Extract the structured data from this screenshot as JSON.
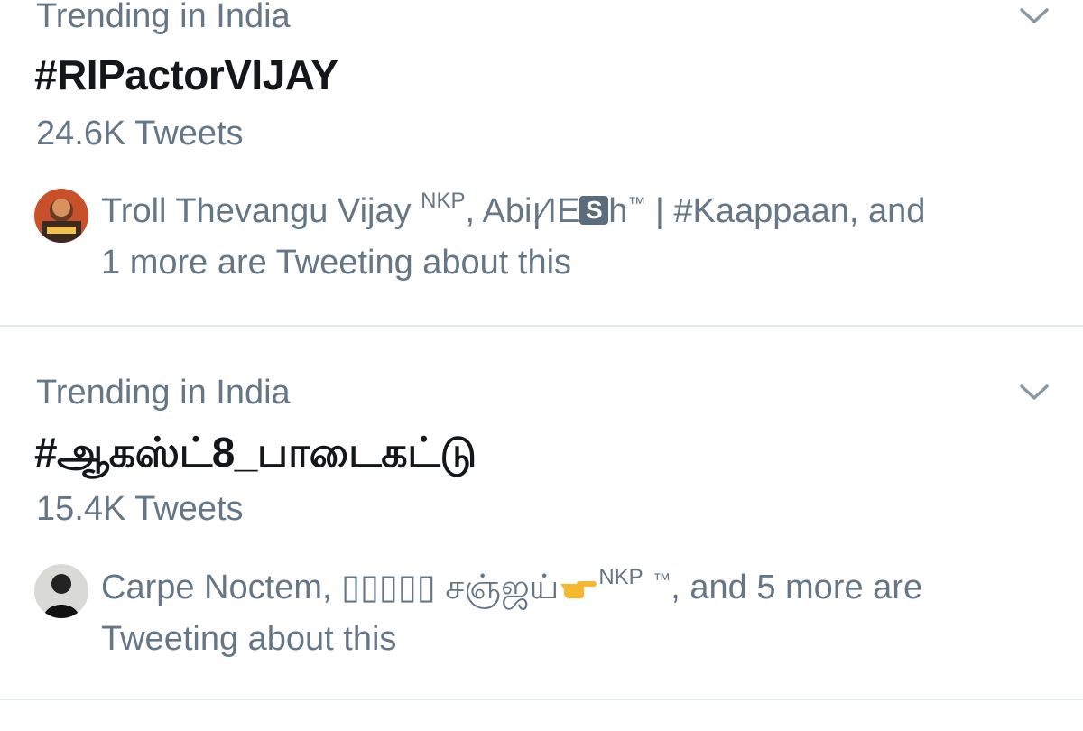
{
  "trends": [
    {
      "context": "Trending in India",
      "hashtag": "#RIPactorVIJAY",
      "tweet_count": "24.6K Tweets",
      "avatar_icon": "user-avatar",
      "activity": {
        "name_1": "Troll Thevangu Vijay",
        "name_1_sup": "NKP",
        "sep_1": ", ",
        "name_2_a": "Abiꞁ⁄ΙΕ",
        "name_2_box": "S",
        "name_2_b": "h",
        "name_2_tm": "™",
        "name_2_c": " | #Kaappaan, and",
        "rest": "1 more are Tweeting about this"
      }
    },
    {
      "context": "Trending in India",
      "hashtag": "#ஆகஸ்ட்8_பாடைகட்டு",
      "tweet_count": "15.4K Tweets",
      "avatar_icon": "user-avatar",
      "activity": {
        "name_1": "Carpe Noctem, ▯▯▯▯▯ சஞ்ஜய்",
        "emoji": "pointing-finger-icon",
        "name_1_sup": "NKP",
        "name_1_tm": "™",
        "rest_a": ", and 5 more are",
        "rest_b": "Tweeting about this"
      }
    }
  ],
  "colors": {
    "secondary_text": "#657786",
    "primary_text": "#14171a",
    "divider": "#e1e8ed"
  }
}
